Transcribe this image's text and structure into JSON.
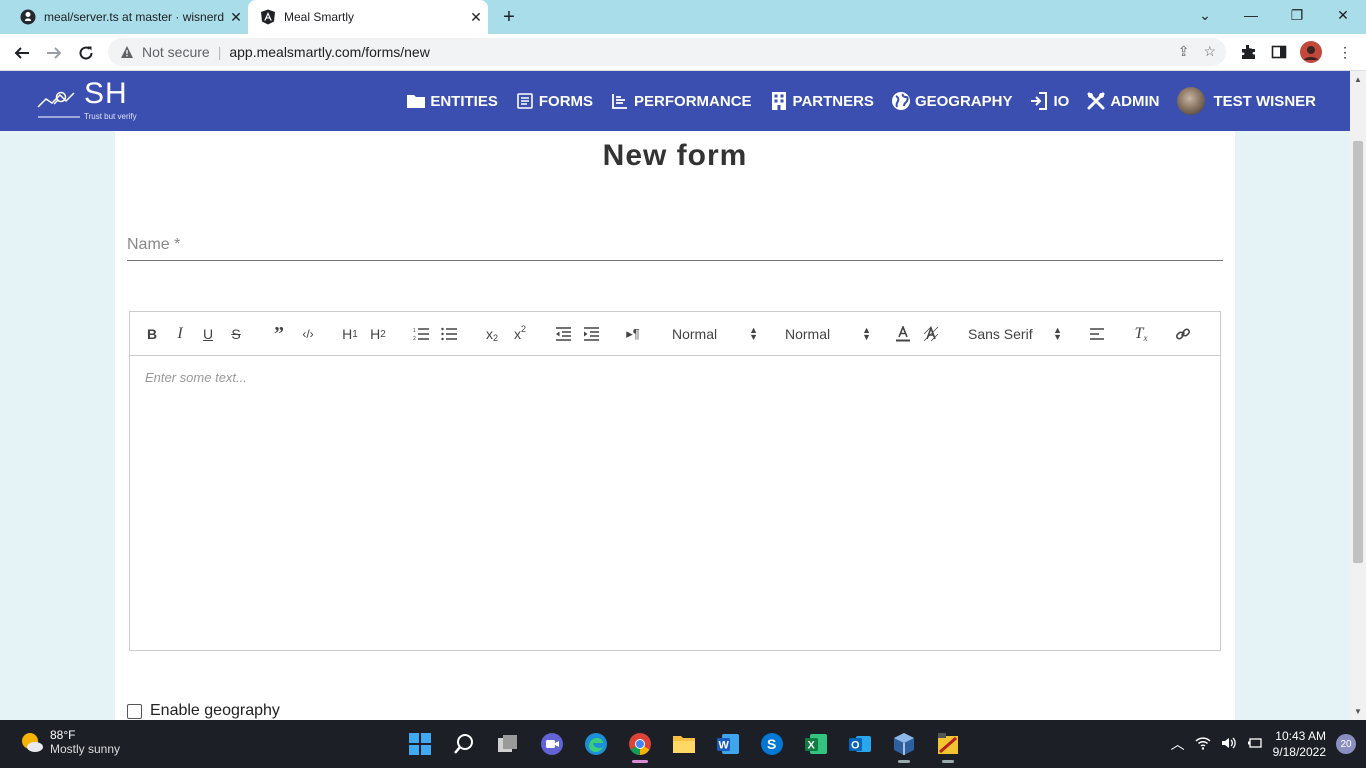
{
  "browser": {
    "tabs": [
      {
        "title": "meal/server.ts at master · wisnerd",
        "icon": "github-icon"
      },
      {
        "title": "Meal Smartly",
        "icon": "angular-icon"
      }
    ],
    "new_tab_label": "+",
    "address": {
      "security_text": "Not secure",
      "separator": "|",
      "url": "app.mealsmartly.com/forms/new"
    }
  },
  "app": {
    "logo": {
      "letters": "SH",
      "tagline": "Trust but verify"
    },
    "nav": [
      {
        "label": "ENTITIES",
        "icon": "folder-icon"
      },
      {
        "label": "FORMS",
        "icon": "form-icon"
      },
      {
        "label": "PERFORMANCE",
        "icon": "chart-icon"
      },
      {
        "label": "PARTNERS",
        "icon": "building-icon"
      },
      {
        "label": "GEOGRAPHY",
        "icon": "globe-icon"
      },
      {
        "label": "IO",
        "icon": "sign-in-icon"
      },
      {
        "label": "ADMIN",
        "icon": "tools-icon"
      }
    ],
    "user": {
      "name": "TEST WISNER"
    }
  },
  "page": {
    "title": "New form",
    "name_field": {
      "placeholder": "Name *",
      "value": ""
    },
    "editor": {
      "toolbar": {
        "header_select": "Normal",
        "size_select": "Normal",
        "font_select": "Sans Serif"
      },
      "placeholder": "Enter some text..."
    },
    "enable_geography_label": "Enable geography"
  },
  "taskbar": {
    "weather": {
      "temp": "88°F",
      "condition": "Mostly sunny"
    },
    "time": "10:43 AM",
    "date": "9/18/2022",
    "notification_count": "20"
  }
}
